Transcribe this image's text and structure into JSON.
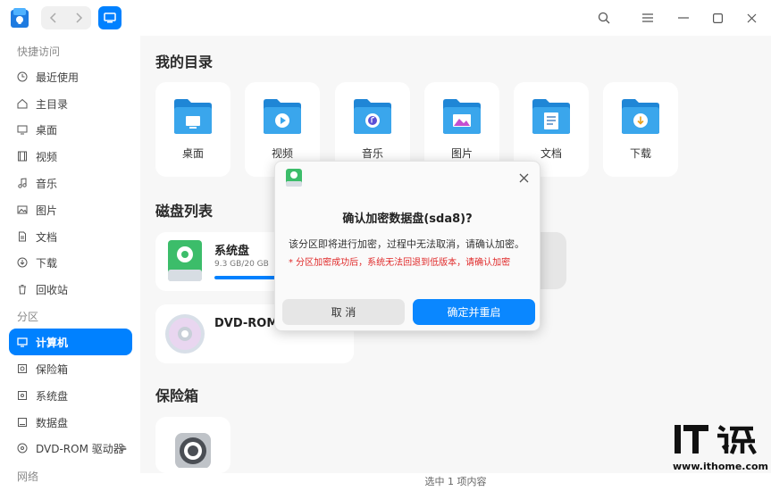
{
  "titlebar": {
    "back_icon": "chevron-left-icon",
    "forward_icon": "chevron-right-icon",
    "view_icon": "computer-icon",
    "search_icon": "search-icon",
    "menu_icon": "menu-icon",
    "minimize_icon": "minimize-icon",
    "maximize_icon": "maximize-icon",
    "close_icon": "close-icon"
  },
  "sidebar": {
    "sections": [
      "快捷访问",
      "分区",
      "网络"
    ],
    "items": [
      {
        "label": "最近使用",
        "icon": "clock-icon"
      },
      {
        "label": "主目录",
        "icon": "home-icon"
      },
      {
        "label": "桌面",
        "icon": "desktop-icon"
      },
      {
        "label": "视频",
        "icon": "video-icon"
      },
      {
        "label": "音乐",
        "icon": "music-icon"
      },
      {
        "label": "图片",
        "icon": "picture-icon"
      },
      {
        "label": "文档",
        "icon": "document-icon"
      },
      {
        "label": "下载",
        "icon": "download-icon"
      },
      {
        "label": "回收站",
        "icon": "trash-icon"
      },
      {
        "label": "计算机",
        "icon": "computer-icon"
      },
      {
        "label": "保险箱",
        "icon": "safe-icon"
      },
      {
        "label": "系统盘",
        "icon": "disk-icon"
      },
      {
        "label": "数据盘",
        "icon": "disk-icon"
      },
      {
        "label": "DVD-ROM 驱动器",
        "icon": "dvd-icon"
      }
    ],
    "active_item": "计算机"
  },
  "main": {
    "my_dirs_title": "我的目录",
    "folders": [
      "桌面",
      "视频",
      "音乐",
      "图片",
      "文档",
      "下载"
    ],
    "disk_list_title": "磁盘列表",
    "disks": [
      {
        "name": "系统盘",
        "size": "9.3 GB/20 GB",
        "usage": 0.465
      },
      {
        "name": "DVD-ROM 驱"
      }
    ],
    "vault_title": "保险箱"
  },
  "statusbar": {
    "text": "选中 1 项内容"
  },
  "dialog": {
    "title": "确认加密数据盘(sda8)?",
    "message": "该分区即将进行加密，过程中无法取消，请确认加密。",
    "warning": "* 分区加密成功后，系统无法回退到低版本，请确认加密",
    "cancel_label": "取 消",
    "confirm_label": "确定并重启",
    "close_icon": "close-icon"
  },
  "watermark": {
    "logo": "IT之家",
    "url": "www.ithome.com"
  },
  "colors": {
    "accent": "#0081ff",
    "warning": "#e02a2a",
    "folder": "#2d9cdb"
  }
}
